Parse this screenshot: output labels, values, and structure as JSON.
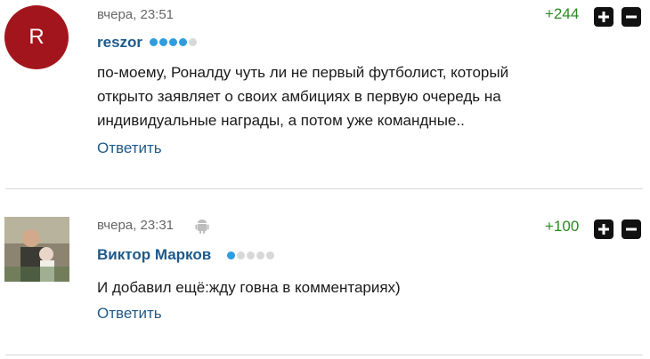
{
  "comments": [
    {
      "avatar_letter": "R",
      "time": "вчера, 23:51",
      "author": "reszor",
      "rating_dots": {
        "filled": 4,
        "total": 5
      },
      "score": "+244",
      "text_lines": [
        "по-моему, Роналду чуть ли не первый футболист, который",
        "открыто заявляет о своих амбициях в первую очередь на",
        "индивидуальные награды, а потом уже командные.."
      ],
      "reply_label": "Ответить"
    },
    {
      "time": "вчера, 23:31",
      "device_icon": "android-icon",
      "author": "Виктор Марков",
      "rating_dots": {
        "filled": 1,
        "total": 5
      },
      "score": "+100",
      "text_lines": [
        "И добавил ещё:жду говна в комментариях)"
      ],
      "reply_label": "Ответить"
    }
  ],
  "colors": {
    "author": "#1e5a8a",
    "score_positive": "#2a8a22",
    "avatar_bg": "#a3151c",
    "rating_on": "#2d9de0",
    "rating_off": "#d8d8d8"
  }
}
